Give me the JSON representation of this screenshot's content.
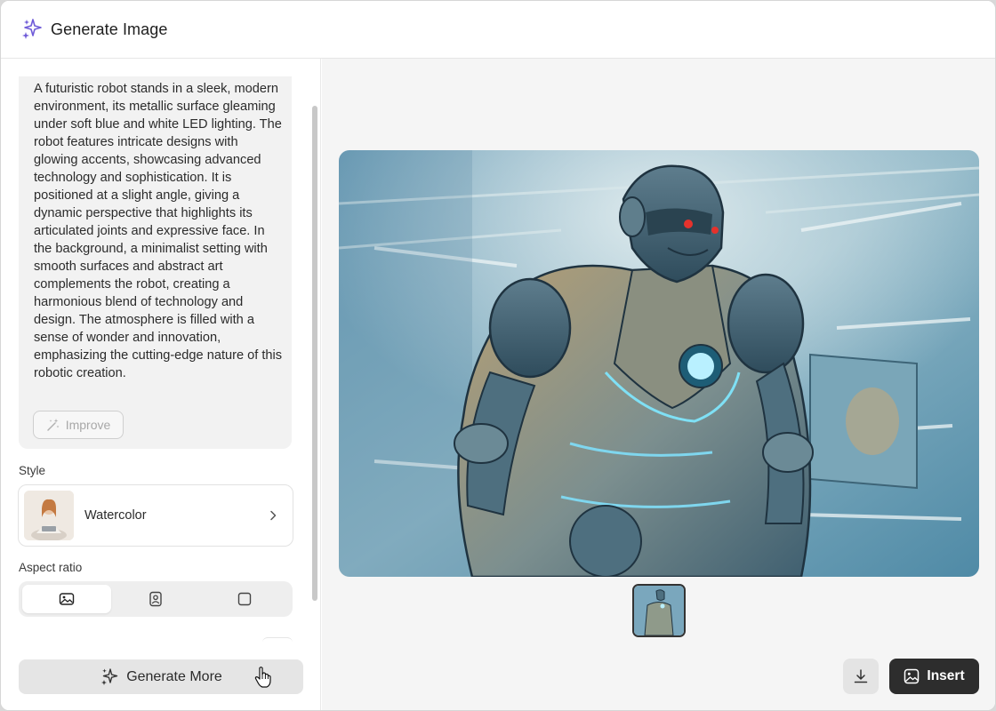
{
  "header": {
    "title": "Generate Image",
    "icon": "sparkle-icon",
    "accent": "#6f5bd8"
  },
  "prompt": {
    "text": "A futuristic robot stands in a sleek, modern environment, its metallic surface gleaming under soft blue and white LED lighting. The robot features intricate designs with glowing accents, showcasing advanced technology and sophistication. It is positioned at a slight angle, giving a dynamic perspective that highlights its articulated joints and expressive face. In the background, a minimalist setting with smooth surfaces and abstract art complements the robot, creating a harmonious blend of technology and design. The atmosphere is filled with a sense of wonder and innovation, emphasizing the cutting-edge nature of this robotic creation.",
    "improve_label": "Improve"
  },
  "style": {
    "label": "Style",
    "selected": "Watercolor"
  },
  "aspect": {
    "label": "Aspect ratio",
    "options": [
      {
        "name": "landscape",
        "icon": "landscape-image-icon",
        "active": true
      },
      {
        "name": "portrait",
        "icon": "portrait-icon",
        "active": false
      },
      {
        "name": "square",
        "icon": "square-icon",
        "active": false
      }
    ]
  },
  "actions": {
    "generate_more": "Generate More",
    "insert": "Insert",
    "download_icon": "download-icon"
  },
  "colors": {
    "insert_bg": "#2d2d2d",
    "panel_bg": "#f5f5f5"
  }
}
